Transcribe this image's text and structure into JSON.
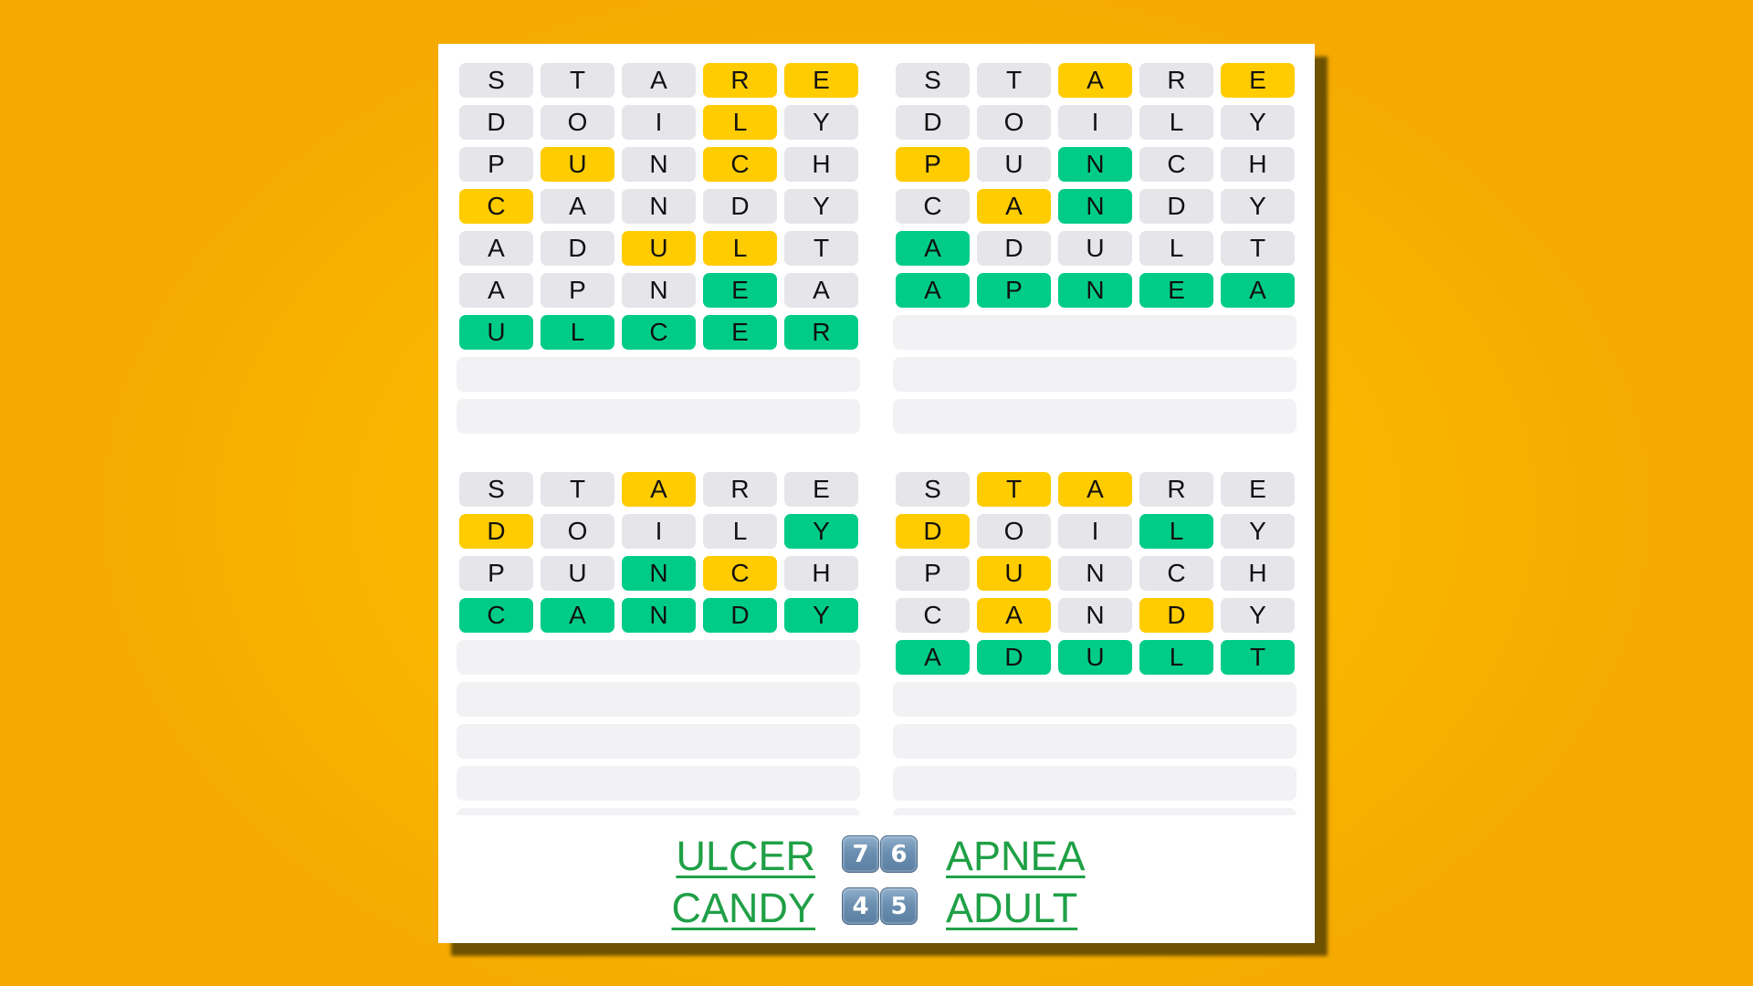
{
  "game": "Quordle",
  "colors": {
    "absent": "#e5e5ea",
    "present": "#ffcc00",
    "correct": "#00cc88",
    "empty": "#f2f2f5",
    "answer_link": "#1fa046"
  },
  "boards": [
    {
      "answer": "ULCER",
      "solved_in": 7,
      "guesses": [
        {
          "letters": [
            "S",
            "T",
            "A",
            "R",
            "E"
          ],
          "states": [
            "absent",
            "absent",
            "absent",
            "present",
            "present"
          ]
        },
        {
          "letters": [
            "D",
            "O",
            "I",
            "L",
            "Y"
          ],
          "states": [
            "absent",
            "absent",
            "absent",
            "present",
            "absent"
          ]
        },
        {
          "letters": [
            "P",
            "U",
            "N",
            "C",
            "H"
          ],
          "states": [
            "absent",
            "present",
            "absent",
            "present",
            "absent"
          ]
        },
        {
          "letters": [
            "C",
            "A",
            "N",
            "D",
            "Y"
          ],
          "states": [
            "present",
            "absent",
            "absent",
            "absent",
            "absent"
          ]
        },
        {
          "letters": [
            "A",
            "D",
            "U",
            "L",
            "T"
          ],
          "states": [
            "absent",
            "absent",
            "present",
            "present",
            "absent"
          ]
        },
        {
          "letters": [
            "A",
            "P",
            "N",
            "E",
            "A"
          ],
          "states": [
            "absent",
            "absent",
            "absent",
            "correct",
            "absent"
          ]
        },
        {
          "letters": [
            "U",
            "L",
            "C",
            "E",
            "R"
          ],
          "states": [
            "correct",
            "correct",
            "correct",
            "correct",
            "correct"
          ]
        }
      ],
      "empty_rows": 2
    },
    {
      "answer": "APNEA",
      "solved_in": 6,
      "guesses": [
        {
          "letters": [
            "S",
            "T",
            "A",
            "R",
            "E"
          ],
          "states": [
            "absent",
            "absent",
            "present",
            "absent",
            "present"
          ]
        },
        {
          "letters": [
            "D",
            "O",
            "I",
            "L",
            "Y"
          ],
          "states": [
            "absent",
            "absent",
            "absent",
            "absent",
            "absent"
          ]
        },
        {
          "letters": [
            "P",
            "U",
            "N",
            "C",
            "H"
          ],
          "states": [
            "present",
            "absent",
            "correct",
            "absent",
            "absent"
          ]
        },
        {
          "letters": [
            "C",
            "A",
            "N",
            "D",
            "Y"
          ],
          "states": [
            "absent",
            "present",
            "correct",
            "absent",
            "absent"
          ]
        },
        {
          "letters": [
            "A",
            "D",
            "U",
            "L",
            "T"
          ],
          "states": [
            "correct",
            "absent",
            "absent",
            "absent",
            "absent"
          ]
        },
        {
          "letters": [
            "A",
            "P",
            "N",
            "E",
            "A"
          ],
          "states": [
            "correct",
            "correct",
            "correct",
            "correct",
            "correct"
          ]
        }
      ],
      "empty_rows": 3
    },
    {
      "answer": "CANDY",
      "solved_in": 4,
      "guesses": [
        {
          "letters": [
            "S",
            "T",
            "A",
            "R",
            "E"
          ],
          "states": [
            "absent",
            "absent",
            "present",
            "absent",
            "absent"
          ]
        },
        {
          "letters": [
            "D",
            "O",
            "I",
            "L",
            "Y"
          ],
          "states": [
            "present",
            "absent",
            "absent",
            "absent",
            "correct"
          ]
        },
        {
          "letters": [
            "P",
            "U",
            "N",
            "C",
            "H"
          ],
          "states": [
            "absent",
            "absent",
            "correct",
            "present",
            "absent"
          ]
        },
        {
          "letters": [
            "C",
            "A",
            "N",
            "D",
            "Y"
          ],
          "states": [
            "correct",
            "correct",
            "correct",
            "correct",
            "correct"
          ]
        }
      ],
      "empty_rows": 5
    },
    {
      "answer": "ADULT",
      "solved_in": 5,
      "guesses": [
        {
          "letters": [
            "S",
            "T",
            "A",
            "R",
            "E"
          ],
          "states": [
            "absent",
            "present",
            "present",
            "absent",
            "absent"
          ]
        },
        {
          "letters": [
            "D",
            "O",
            "I",
            "L",
            "Y"
          ],
          "states": [
            "present",
            "absent",
            "absent",
            "correct",
            "absent"
          ]
        },
        {
          "letters": [
            "P",
            "U",
            "N",
            "C",
            "H"
          ],
          "states": [
            "absent",
            "present",
            "absent",
            "absent",
            "absent"
          ]
        },
        {
          "letters": [
            "C",
            "A",
            "N",
            "D",
            "Y"
          ],
          "states": [
            "absent",
            "present",
            "absent",
            "present",
            "absent"
          ]
        },
        {
          "letters": [
            "A",
            "D",
            "U",
            "L",
            "T"
          ],
          "states": [
            "correct",
            "correct",
            "correct",
            "correct",
            "correct"
          ]
        }
      ],
      "empty_rows": 4
    }
  ],
  "summary": {
    "rows": [
      {
        "left_word": "ULCER",
        "keycaps": [
          "7",
          "6"
        ],
        "right_word": "APNEA"
      },
      {
        "left_word": "CANDY",
        "keycaps": [
          "4",
          "5"
        ],
        "right_word": "ADULT"
      }
    ]
  }
}
